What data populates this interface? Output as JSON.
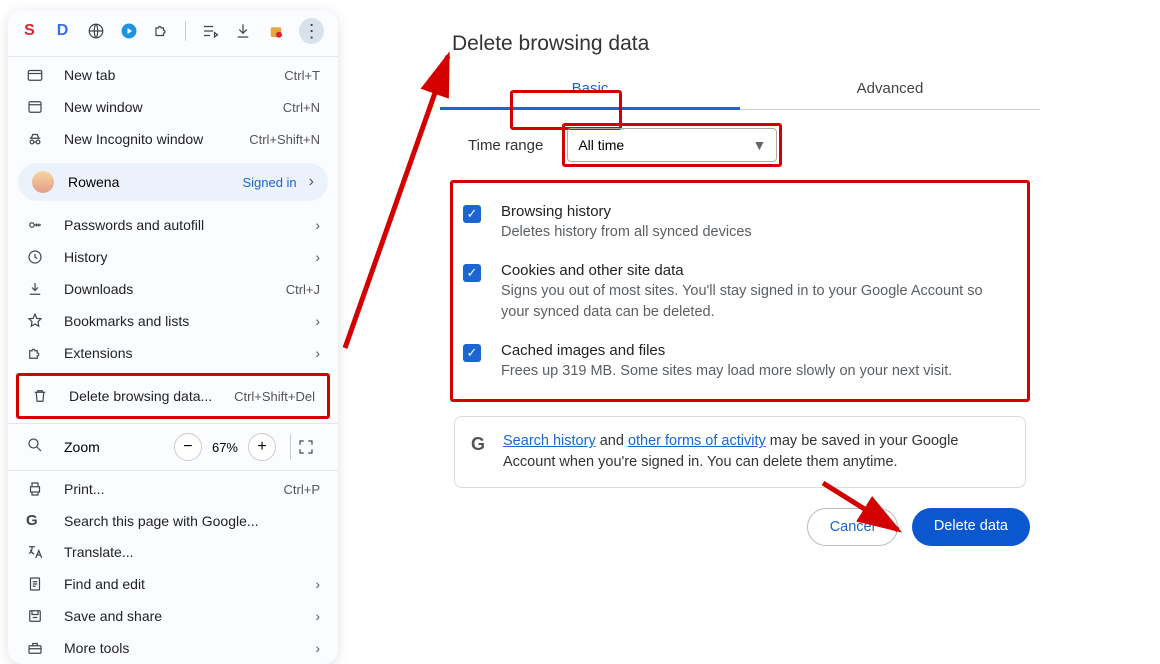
{
  "extensions_bar": {
    "items": [
      "S",
      "D",
      "globe",
      "play",
      "puzzle",
      "playlist",
      "download",
      "bag"
    ],
    "more": "⋮"
  },
  "menu": {
    "new_tab": {
      "label": "New tab",
      "shortcut": "Ctrl+T"
    },
    "new_window": {
      "label": "New window",
      "shortcut": "Ctrl+N"
    },
    "incognito": {
      "label": "New Incognito window",
      "shortcut": "Ctrl+Shift+N"
    },
    "profile": {
      "name": "Rowena",
      "status": "Signed in"
    },
    "passwords": {
      "label": "Passwords and autofill"
    },
    "history": {
      "label": "History"
    },
    "downloads": {
      "label": "Downloads",
      "shortcut": "Ctrl+J"
    },
    "bookmarks": {
      "label": "Bookmarks and lists"
    },
    "extensions": {
      "label": "Extensions"
    },
    "delete_data": {
      "label": "Delete browsing data...",
      "shortcut": "Ctrl+Shift+Del"
    },
    "zoom": {
      "label": "Zoom",
      "value": "67%"
    },
    "print": {
      "label": "Print...",
      "shortcut": "Ctrl+P"
    },
    "search_page": {
      "label": "Search this page with Google..."
    },
    "translate": {
      "label": "Translate..."
    },
    "find_edit": {
      "label": "Find and edit"
    },
    "save_share": {
      "label": "Save and share"
    },
    "more_tools": {
      "label": "More tools"
    }
  },
  "dialog": {
    "title": "Delete browsing data",
    "tabs": {
      "basic": "Basic",
      "advanced": "Advanced"
    },
    "time_range": {
      "label": "Time range",
      "value": "All time"
    },
    "options": {
      "browsing": {
        "title": "Browsing history",
        "desc": "Deletes history from all synced devices"
      },
      "cookies": {
        "title": "Cookies and other site data",
        "desc": "Signs you out of most sites. You'll stay signed in to your Google Account so your synced data can be deleted."
      },
      "cache": {
        "title": "Cached images and files",
        "desc": "Frees up 319 MB. Some sites may load more slowly on your next visit."
      }
    },
    "notice": {
      "link1": "Search history",
      "mid1": " and ",
      "link2": "other forms of activity",
      "rest": " may be saved in your Google Account when you're signed in. You can delete them anytime."
    },
    "buttons": {
      "cancel": "Cancel",
      "delete": "Delete data"
    }
  }
}
